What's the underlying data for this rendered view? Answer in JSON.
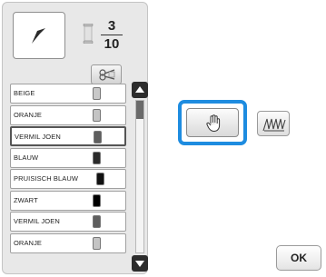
{
  "counter": {
    "current": "3",
    "total": "10"
  },
  "threads": [
    {
      "label": "BEIGE",
      "color": "#c8c8c8",
      "selected": false
    },
    {
      "label": "ORANJE",
      "color": "#c4c4c4",
      "selected": false
    },
    {
      "label": "VERMIL JOEN",
      "color": "#5e5e5e",
      "selected": true
    },
    {
      "label": "BLAUW",
      "color": "#2b2b2b",
      "selected": false
    },
    {
      "label": "PRUISISCH BLAUW",
      "color": "#111111",
      "selected": false
    },
    {
      "label": "ZWART",
      "color": "#000000",
      "selected": false
    },
    {
      "label": "VERMIL JOEN",
      "color": "#5e5e5e",
      "selected": false
    },
    {
      "label": "ORANJE",
      "color": "#c4c4c4",
      "selected": false
    }
  ],
  "buttons": {
    "ok_label": "OK"
  },
  "icons": {
    "preview": "pattern-preview-icon",
    "spool": "thread-spool-icon",
    "scissor": "thread-cut-icon",
    "hand": "hand-icon",
    "stitch": "stitch-icon"
  }
}
